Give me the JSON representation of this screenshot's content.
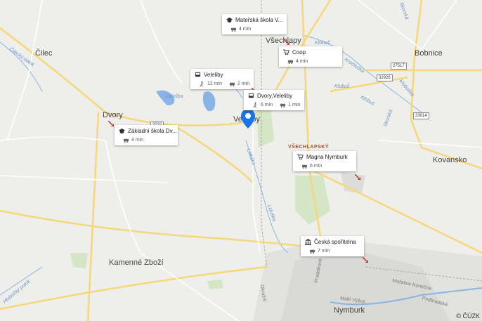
{
  "places": [
    {
      "id": "cilec",
      "name": "Čilec"
    },
    {
      "id": "dvory",
      "name": "Dvory"
    },
    {
      "id": "veleliby",
      "name": "Veleliby"
    },
    {
      "id": "vsechlapy",
      "name": "Všechlapy"
    },
    {
      "id": "bobnice",
      "name": "Bobnice"
    },
    {
      "id": "kovansko",
      "name": "Kovansko"
    },
    {
      "id": "kamenne",
      "name": "Kamenné Zboží"
    },
    {
      "id": "nymburk",
      "name": "Nymburk"
    }
  ],
  "district": "VŠECHLAPSKÝ",
  "waters": [
    "Čilecký potok",
    "Liduška",
    "Liduška",
    "Liduška",
    "Klobuš",
    "Klobuš",
    "Klobuš",
    "Klobuška",
    "Kročiluška",
    "Hlubočký potok",
    "Skorská",
    "Skorská"
  ],
  "streets": [
    "Mařatice Konečna",
    "Podbradská",
    "Malé Výšce",
    "Okružní",
    "Pradelkova"
  ],
  "road_numbers": [
    "3232",
    "27517",
    "32926",
    "33014"
  ],
  "pois": [
    {
      "id": "ms",
      "title": "Mateřská škola V...",
      "icon": "school-icon",
      "rows": [
        {
          "icon": "car-icon",
          "text": "4 min"
        }
      ]
    },
    {
      "id": "coop",
      "title": "Coop",
      "icon": "cart-icon",
      "rows": [
        {
          "icon": "car-icon",
          "text": "4 min"
        }
      ]
    },
    {
      "id": "vel",
      "title": "Veleliby",
      "icon": "bus-icon",
      "rows": [
        {
          "icon": "walk-icon",
          "text": "12 min"
        },
        {
          "icon": "car-icon",
          "text": "2 min"
        }
      ]
    },
    {
      "id": "dv",
      "title": "Dvory,Veleliby",
      "icon": "bus-icon",
      "rows": [
        {
          "icon": "walk-icon",
          "text": "6 min"
        },
        {
          "icon": "car-icon",
          "text": "1 min"
        }
      ]
    },
    {
      "id": "zs",
      "title": "Základní škola Dv...",
      "icon": "school-icon",
      "rows": [
        {
          "icon": "car-icon",
          "text": "4 min"
        }
      ]
    },
    {
      "id": "magna",
      "title": "Magna Nymburk",
      "icon": "cart-icon",
      "rows": [
        {
          "icon": "car-icon",
          "text": "6 min"
        }
      ]
    },
    {
      "id": "cs",
      "title": "Česká spořitelna",
      "icon": "bank-icon",
      "rows": [
        {
          "icon": "car-icon",
          "text": "7 min"
        }
      ]
    }
  ],
  "copyright": "© ČÚZK",
  "colors": {
    "water": "#8ab4e8",
    "road_main": "#f6d77a",
    "road_minor": "#ffffff",
    "pin": "#1a73e8",
    "urban": "#dcdcd8",
    "green": "#cfe3c0"
  }
}
